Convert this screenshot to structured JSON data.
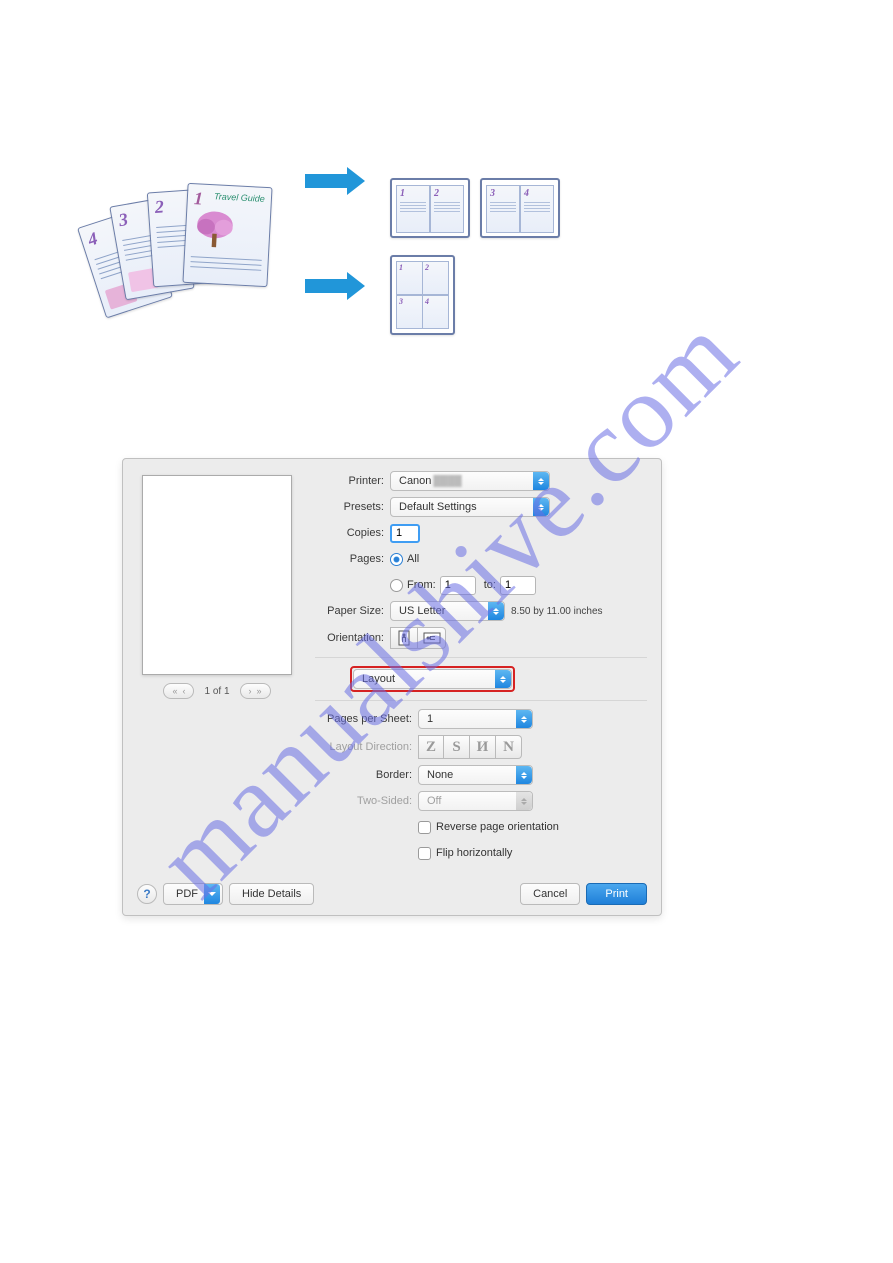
{
  "illustration": {
    "stack": {
      "p1_num": "1",
      "p1_title": "Travel Guide",
      "p2_num": "2",
      "p3_num": "3",
      "p4_num": "4"
    },
    "sheetA": {
      "c1": "1",
      "c2": "2"
    },
    "sheetB": {
      "c1": "3",
      "c2": "4"
    },
    "sheet4up": {
      "q1": "1",
      "q2": "2",
      "q3": "3",
      "q4": "4"
    }
  },
  "dialog": {
    "printer_label": "Printer:",
    "printer_value": "Canon",
    "presets_label": "Presets:",
    "presets_value": "Default Settings",
    "copies_label": "Copies:",
    "copies_value": "1",
    "pages_label": "Pages:",
    "pages_all": "All",
    "pages_from_label": "From:",
    "pages_from_value": "1",
    "pages_to_label": "to:",
    "pages_to_value": "1",
    "papersize_label": "Paper Size:",
    "papersize_value": "US Letter",
    "papersize_note": "8.50 by 11.00 inches",
    "orientation_label": "Orientation:",
    "section_popup": "Layout",
    "pps_label": "Pages per Sheet:",
    "pps_value": "1",
    "layoutdir_label": "Layout Direction:",
    "dir1": "Z",
    "dir2": "S",
    "dir3": "И",
    "dir4": "N",
    "border_label": "Border:",
    "border_value": "None",
    "twosided_label": "Two-Sided:",
    "twosided_value": "Off",
    "reverse_label": "Reverse page orientation",
    "flip_label": "Flip horizontally",
    "help": "?",
    "pdf": "PDF",
    "hide_details": "Hide Details",
    "cancel": "Cancel",
    "print": "Print",
    "page_indicator": "1 of 1"
  },
  "watermark": "manualshive.com"
}
